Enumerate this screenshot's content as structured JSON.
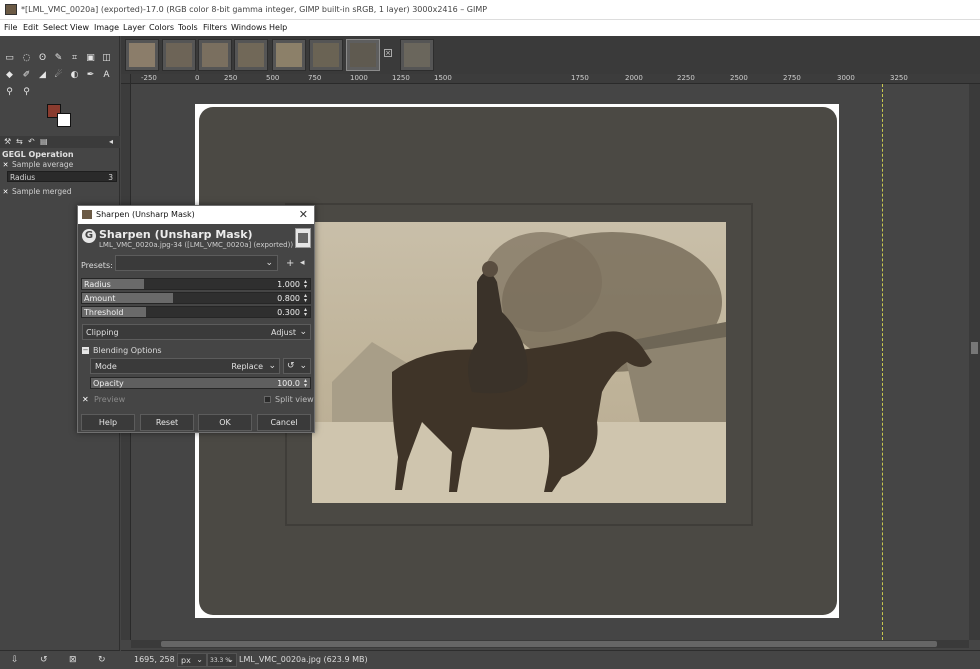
{
  "window": {
    "title": "*[LML_VMC_0020a] (exported)-17.0 (RGB color 8-bit gamma integer, GIMP built-in sRGB, 1 layer) 3000x2416 – GIMP"
  },
  "menu": [
    "File",
    "Edit",
    "Select",
    "View",
    "Image",
    "Layer",
    "Colors",
    "Tools",
    "Filters",
    "Windows",
    "Help"
  ],
  "toolbox": {
    "fg_color": "#8a3b2e",
    "bg_color": "#ffffff",
    "options_title": "GEGL Operation",
    "sample_average": "Sample average",
    "radius_label": "Radius",
    "radius_value": "3",
    "sample_merged": "Sample merged"
  },
  "ruler": {
    "ticks": [
      "-250",
      "0",
      "250",
      "500",
      "750",
      "1000",
      "1250",
      "1500",
      "1750",
      "2000",
      "2250",
      "2500",
      "2750",
      "3000",
      "3250"
    ]
  },
  "dialog": {
    "window_title": "Sharpen (Unsharp Mask)",
    "heading": "Sharpen (Unsharp Mask)",
    "subheading": "LML_VMC_0020a.jpg-34 ([LML_VMC_0020a] (exported))",
    "presets_label": "Presets:",
    "radius": {
      "label": "Radius",
      "value": "1.000",
      "fraction": 0.27
    },
    "amount": {
      "label": "Amount",
      "value": "0.800",
      "fraction": 0.4
    },
    "threshold": {
      "label": "Threshold",
      "value": "0.300",
      "fraction": 0.28
    },
    "clipping_label": "Clipping",
    "clipping_value": "Adjust",
    "blending_label": "Blending Options",
    "mode_label": "Mode",
    "mode_value": "Replace",
    "opacity": {
      "label": "Opacity",
      "value": "100.0",
      "fraction": 1.0
    },
    "preview_label": "Preview",
    "split_view_label": "Split view",
    "buttons": {
      "help": "Help",
      "reset": "Reset",
      "ok": "OK",
      "cancel": "Cancel"
    }
  },
  "status": {
    "coords": "1695, 258",
    "unit": "px",
    "zoom": "33.3 %",
    "file_info": "LML_VMC_0020a.jpg (623.9 MB)"
  }
}
